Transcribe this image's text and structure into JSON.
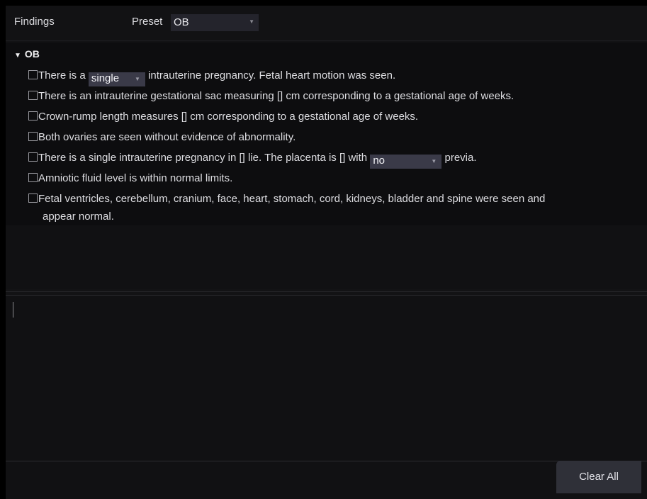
{
  "header": {
    "title": "Findings",
    "preset_label": "Preset",
    "preset_value": "OB"
  },
  "group": {
    "name": "OB",
    "items": [
      {
        "parts": [
          "There is a ",
          " intrauterine pregnancy. Fetal heart motion was seen."
        ],
        "select": "single"
      },
      {
        "text": "There is an intrauterine gestational sac measuring [] cm corresponding to a gestational age of weeks."
      },
      {
        "text": "Crown-rump length measures [] cm corresponding to a gestational age of weeks."
      },
      {
        "text": "Both ovaries are seen without evidence of abnormality."
      },
      {
        "parts": [
          "There is a single intrauterine pregnancy in [] lie. The placenta is [] with ",
          " previa."
        ],
        "select": "no"
      },
      {
        "text": "Amniotic fluid level is within normal limits."
      },
      {
        "text": "Fetal ventricles, cerebellum, cranium, face, heart, stomach, cord, kidneys, bladder and spine were seen and",
        "continuation": "appear normal."
      }
    ]
  },
  "editor": {
    "value": ""
  },
  "footer": {
    "clear_all_label": "Clear All"
  }
}
